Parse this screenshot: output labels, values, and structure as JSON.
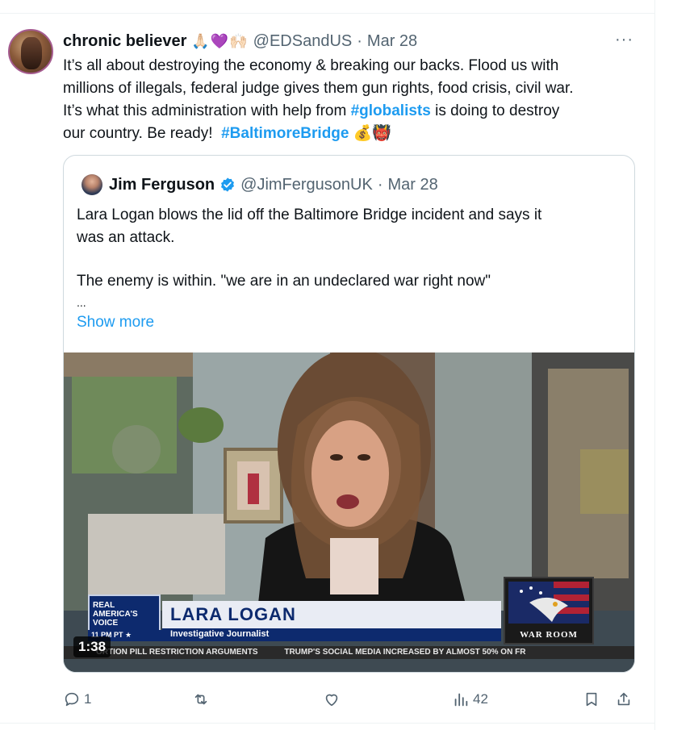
{
  "tweet": {
    "display_name": "chronic believer",
    "emojis": "🙏🏻💜🙌🏻",
    "handle": "@EDSandUS",
    "date": "Mar 28",
    "lines": [
      "It’s all about destroying the economy & breaking our backs. Flood us with",
      "millions of illegals, federal judge gives them gun rights, food crisis, civil war.",
      "It’s what this administration with help from",
      "is doing to destroy",
      "our country. Be ready!"
    ],
    "hashtags": [
      "#globalists",
      "#BaltimoreBridge"
    ],
    "trailing_emojis": "💰👹",
    "more_label": "···"
  },
  "quote": {
    "display_name": "Jim Ferguson",
    "handle": "@JimFergusonUK",
    "date": "Mar 28",
    "lines": [
      "Lara Logan blows the lid off the Baltimore Bridge incident and says it",
      "was an attack.",
      "The enemy is within. \"we are in an undeclared war right now\""
    ],
    "ellipsis": "...",
    "show_more": "Show more"
  },
  "video": {
    "duration": "1:38",
    "network_logo": [
      "REAL",
      "AMERICA'S",
      "VOICE"
    ],
    "lower_third_name": "LARA LOGAN",
    "lower_third_title": "Investigative Journalist",
    "time_strip": "11 PM PT ★",
    "warroom_label": "WAR ROOM",
    "ticker": [
      "ORTION PILL RESTRICTION ARGUMENTS",
      "TRUMP'S SOCIAL MEDIA INCREASED BY ALMOST 50% ON FR"
    ]
  },
  "actions": {
    "reply_count": "1",
    "repost_count": "",
    "like_count": "",
    "views_count": "42"
  },
  "colors": {
    "link": "#1d9bf0",
    "secondary_text": "#536471",
    "border": "#cfd9de",
    "verified": "#1d9bf0"
  }
}
